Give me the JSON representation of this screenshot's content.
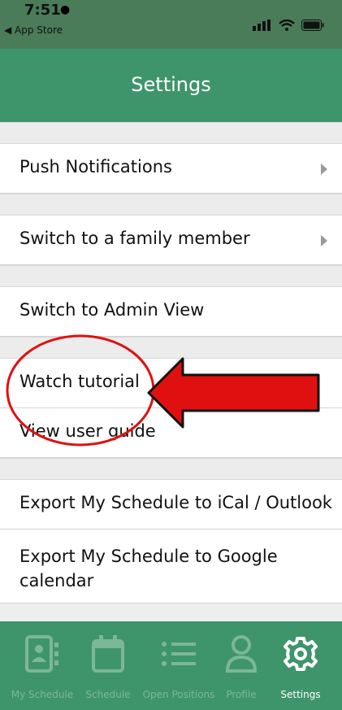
{
  "status": {
    "time": "7:51",
    "back_label": "◀ App Store"
  },
  "header": {
    "title": "Settings"
  },
  "settings": [
    {
      "label": "Push Notifications",
      "has_arrow": true
    },
    {
      "label": "Switch to a family member",
      "has_arrow": true
    },
    {
      "label": "Switch to Admin View",
      "has_arrow": false
    },
    {
      "label": "Watch tutorial",
      "has_arrow": false
    },
    {
      "label": "View user guide",
      "has_arrow": false
    },
    {
      "label": "Export My Schedule to iCal / Outlook",
      "has_arrow": false
    },
    {
      "label": "Export My Schedule to Google calendar",
      "has_arrow": false
    }
  ],
  "tabs": [
    {
      "label": "My Schedule",
      "icon": "contact-book-icon",
      "active": false
    },
    {
      "label": "Schedule",
      "icon": "calendar-icon",
      "active": false
    },
    {
      "label": "Open Positions",
      "icon": "list-icon",
      "active": false
    },
    {
      "label": "Profile",
      "icon": "person-icon",
      "active": false
    },
    {
      "label": "Settings",
      "icon": "gear-icon",
      "active": true
    }
  ],
  "colors": {
    "header_green": "#3f956b",
    "annotation_red": "#e01010"
  }
}
